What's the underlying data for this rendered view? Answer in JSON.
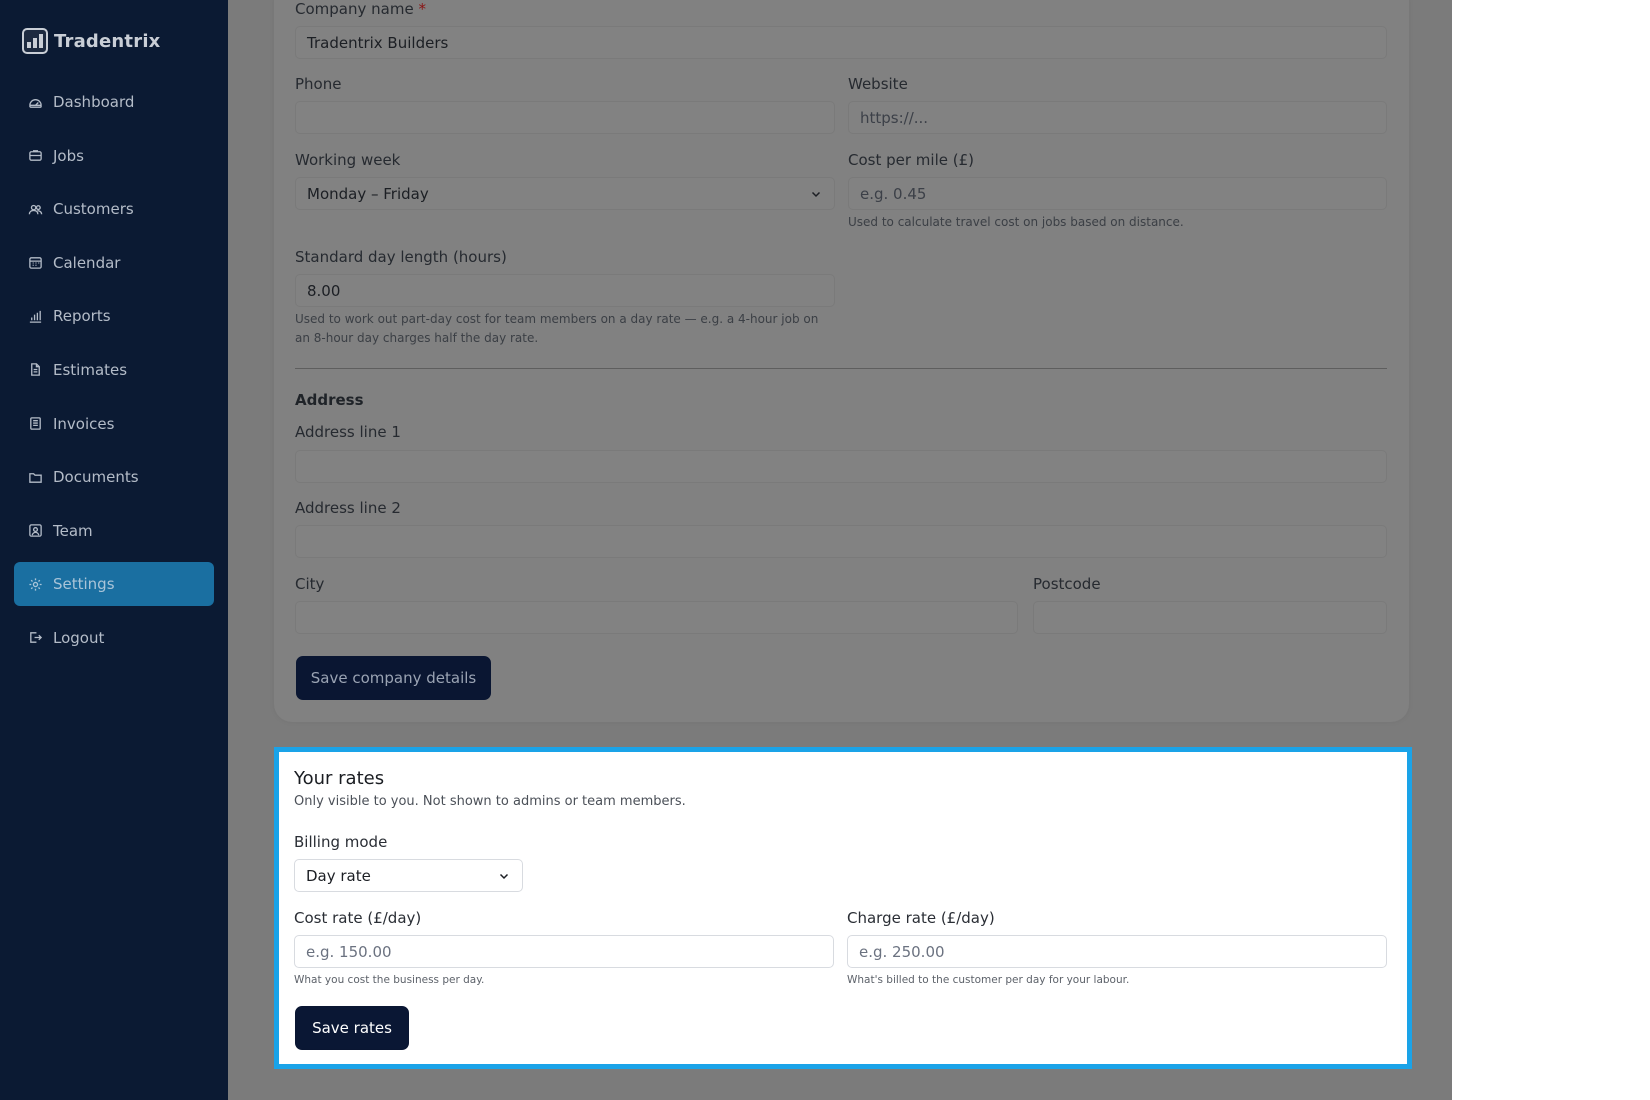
{
  "brand": {
    "name": "Tradentrix"
  },
  "nav": [
    {
      "label": "Dashboard",
      "icon": "dashboard-icon",
      "active": false
    },
    {
      "label": "Jobs",
      "icon": "briefcase-icon",
      "active": false
    },
    {
      "label": "Customers",
      "icon": "users-icon",
      "active": false
    },
    {
      "label": "Calendar",
      "icon": "calendar-icon",
      "active": false
    },
    {
      "label": "Reports",
      "icon": "bar-chart-icon",
      "active": false
    },
    {
      "label": "Estimates",
      "icon": "file-icon",
      "active": false
    },
    {
      "label": "Invoices",
      "icon": "receipt-icon",
      "active": false
    },
    {
      "label": "Documents",
      "icon": "folder-icon",
      "active": false
    },
    {
      "label": "Team",
      "icon": "team-icon",
      "active": false
    },
    {
      "label": "Settings",
      "icon": "gear-icon",
      "active": true
    },
    {
      "label": "Logout",
      "icon": "logout-icon",
      "active": false
    }
  ],
  "company": {
    "name_label": "Company name",
    "name_required": "*",
    "name_value": "Tradentrix Builders",
    "phone_label": "Phone",
    "phone_value": "",
    "website_label": "Website",
    "website_placeholder": "https://...",
    "working_week_label": "Working week",
    "working_week_value": "Monday – Friday",
    "cost_per_mile_label": "Cost per mile (£)",
    "cost_per_mile_placeholder": "e.g. 0.45",
    "cost_per_mile_help": "Used to calculate travel cost on jobs based on distance.",
    "day_length_label": "Standard day length (hours)",
    "day_length_value": "8.00",
    "day_length_help_1": "Used to work out part-day cost for team members on a day rate — e.g. a 4-hour job on",
    "day_length_help_2": "an 8-hour day charges half the day rate.",
    "address_title": "Address",
    "address1_label": "Address line 1",
    "address2_label": "Address line 2",
    "city_label": "City",
    "postcode_label": "Postcode",
    "save_label": "Save company details"
  },
  "rates": {
    "title": "Your rates",
    "subtitle": "Only visible to you. Not shown to admins or team members.",
    "billing_mode_label": "Billing mode",
    "billing_mode_value": "Day rate",
    "cost_rate_label": "Cost rate (£/day)",
    "cost_rate_placeholder": "e.g. 150.00",
    "cost_rate_help": "What you cost the business per day.",
    "charge_rate_label": "Charge rate (£/day)",
    "charge_rate_placeholder": "e.g. 250.00",
    "charge_rate_help": "What's billed to the customer per day for your labour.",
    "save_label": "Save rates"
  },
  "colors": {
    "sidebar_bg": "#0b1a33",
    "active_nav": "#1a6fa1",
    "highlight_border": "#1aa3e8",
    "button_dark": "#0a1734"
  }
}
